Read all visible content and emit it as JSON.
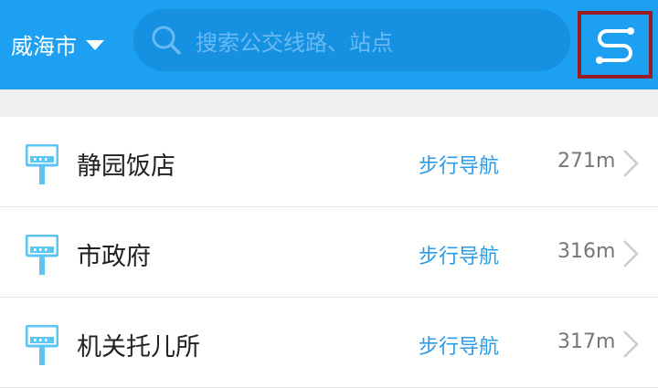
{
  "header": {
    "city": "威海市",
    "search_placeholder": "搜索公交线路、站点"
  },
  "stations": [
    {
      "name": "静园饭店",
      "action": "步行导航",
      "distance": "271m"
    },
    {
      "name": "市政府",
      "action": "步行导航",
      "distance": "316m"
    },
    {
      "name": "机关托儿所",
      "action": "步行导航",
      "distance": "317m"
    }
  ],
  "colors": {
    "header_bg": "#1ea0f2",
    "search_bg": "#1691e2",
    "accent": "#2a9ce8",
    "stop_icon": "#5cc6f0",
    "highlight_box": "#9b1b24"
  }
}
